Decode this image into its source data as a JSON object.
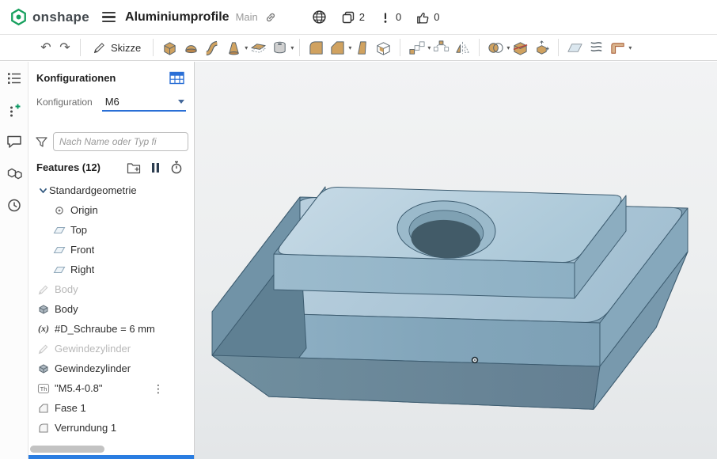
{
  "header": {
    "app_name": "onshape",
    "doc_title": "Aluminiumprofile",
    "workspace": "Main",
    "copies_count": "2",
    "alerts_count": "0",
    "likes_count": "0"
  },
  "toolbar": {
    "undo_glyph": "↶",
    "redo_glyph": "↷",
    "sketch_label": "Skizze",
    "icons": [
      {
        "name": "extrude"
      },
      {
        "name": "revolve"
      },
      {
        "name": "sweep"
      },
      {
        "name": "loft",
        "caret": true
      },
      {
        "name": "thicken"
      },
      {
        "name": "hole",
        "caret": true,
        "sep_after": true
      },
      {
        "name": "fillet"
      },
      {
        "name": "chamfer",
        "caret": true
      },
      {
        "name": "draft"
      },
      {
        "name": "shell",
        "sep_after": true
      },
      {
        "name": "linear-pattern",
        "caret": true
      },
      {
        "name": "circular-pattern"
      },
      {
        "name": "mirror",
        "sep_after": true
      },
      {
        "name": "boolean",
        "caret": true
      },
      {
        "name": "split"
      },
      {
        "name": "transform",
        "sep_after": true
      },
      {
        "name": "plane"
      },
      {
        "name": "helix"
      },
      {
        "name": "sheetmetal",
        "caret": true
      }
    ]
  },
  "left_rail": {
    "icons": [
      {
        "name": "feature-list"
      },
      {
        "name": "insert"
      },
      {
        "name": "comments"
      },
      {
        "name": "parts"
      },
      {
        "name": "history"
      }
    ]
  },
  "panel": {
    "title": "Konfigurationen",
    "config_label": "Konfiguration",
    "config_value": "M6",
    "filter_placeholder": "Nach Name oder Typ fi",
    "features_header": "Features (12)",
    "tree": [
      {
        "label": "Standardgeometrie",
        "icon": "group",
        "indent": 0
      },
      {
        "label": "Origin",
        "icon": "origin",
        "indent": 1
      },
      {
        "label": "Top",
        "icon": "plane",
        "indent": 1
      },
      {
        "label": "Front",
        "icon": "plane",
        "indent": 1
      },
      {
        "label": "Right",
        "icon": "plane",
        "indent": 1
      },
      {
        "label": "Body",
        "icon": "sketch",
        "indent": 0,
        "suppressed": true
      },
      {
        "label": "Body",
        "icon": "extrude",
        "indent": 0
      },
      {
        "label": "#D_Schraube = 6 mm",
        "icon": "variable",
        "indent": 0
      },
      {
        "label": "Gewindezylinder",
        "icon": "sketch",
        "indent": 0,
        "suppressed": true
      },
      {
        "label": "Gewindezylinder",
        "icon": "extrude",
        "indent": 0
      },
      {
        "label": "\"M5.4-0.8\"",
        "icon": "thread",
        "indent": 0,
        "menu": true
      },
      {
        "label": "Fase 1",
        "icon": "chamfer",
        "indent": 0
      },
      {
        "label": "Verrundung 1",
        "icon": "fillet",
        "indent": 0
      }
    ]
  },
  "viewport": {
    "part_color": "#aecbdc",
    "background": "#ededef",
    "vertex_marker": true
  }
}
